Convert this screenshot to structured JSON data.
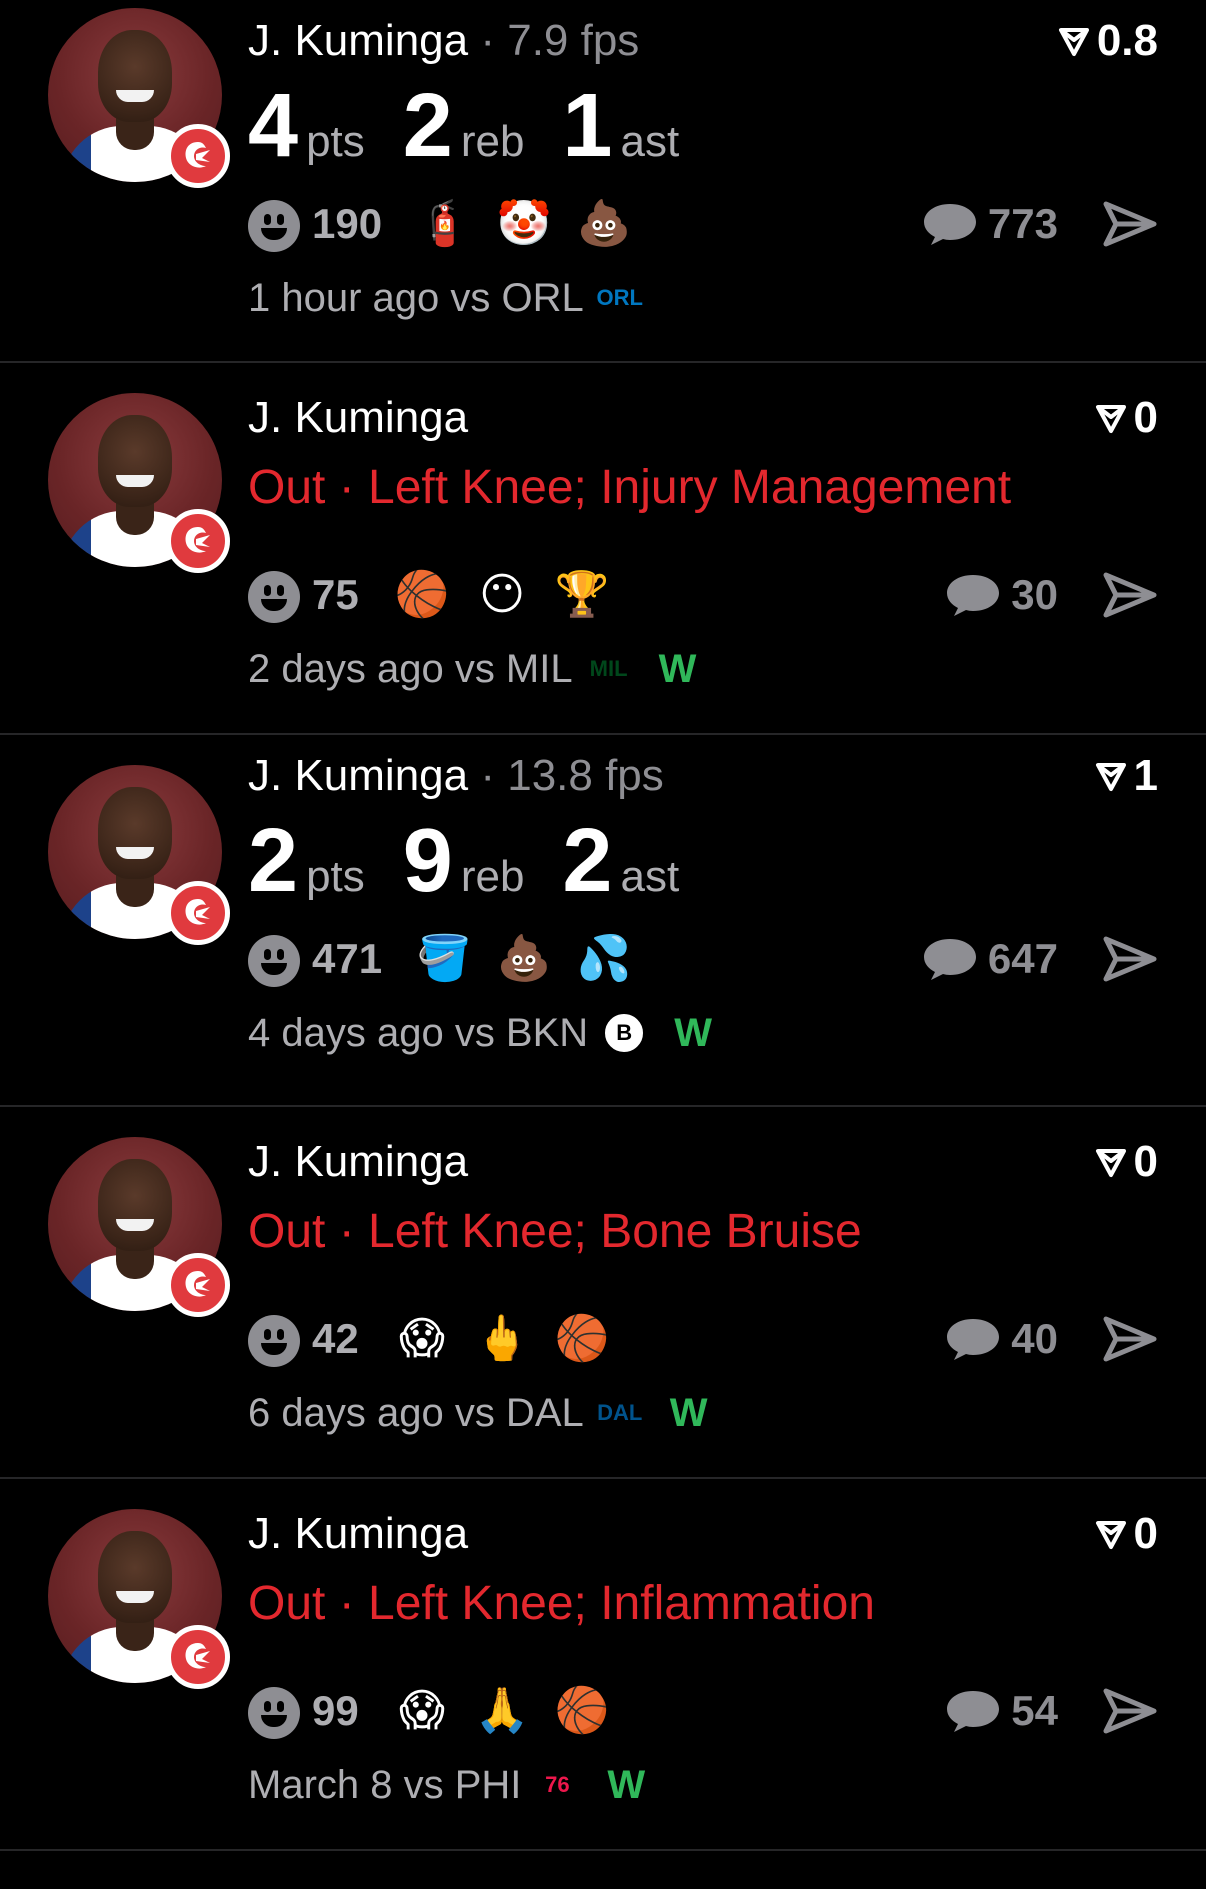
{
  "posts": [
    {
      "name": "J. Kuminga",
      "fps": "7.9 fps",
      "score": "0.8",
      "type": "stats",
      "stats": [
        {
          "num": "4",
          "unit": "pts"
        },
        {
          "num": "2",
          "unit": "reb"
        },
        {
          "num": "1",
          "unit": "ast"
        }
      ],
      "reaction_count": "190",
      "emojis": [
        "🧯",
        "🤡",
        "💩"
      ],
      "comment_count": "773",
      "meta": "1 hour ago vs ORL",
      "opponent_logo": "ORL",
      "opponent_color": "#0077c0",
      "result": ""
    },
    {
      "name": "J. Kuminga",
      "score": "0",
      "type": "injury",
      "injury": "Out · Left Knee; Injury Management",
      "reaction_count": "75",
      "emojis": [
        "🏀",
        "😶",
        "🏆"
      ],
      "comment_count": "30",
      "meta": "2 days ago vs MIL",
      "opponent_logo": "MIL",
      "opponent_color": "#00471b",
      "result": "W"
    },
    {
      "name": "J. Kuminga",
      "fps": "13.8 fps",
      "score": "1",
      "type": "stats",
      "stats": [
        {
          "num": "2",
          "unit": "pts"
        },
        {
          "num": "9",
          "unit": "reb"
        },
        {
          "num": "2",
          "unit": "ast"
        }
      ],
      "reaction_count": "471",
      "emojis": [
        "🪣",
        "💩",
        "💦"
      ],
      "comment_count": "647",
      "meta": "4 days ago vs BKN",
      "opponent_logo": "B",
      "opponent_color": "#ffffff",
      "result": "W"
    },
    {
      "name": "J. Kuminga",
      "score": "0",
      "type": "injury",
      "injury": "Out · Left Knee; Bone Bruise",
      "reaction_count": "42",
      "emojis": [
        "😱",
        "🖕",
        "🏀"
      ],
      "comment_count": "40",
      "meta": "6 days ago vs DAL",
      "opponent_logo": "DAL",
      "opponent_color": "#00538c",
      "result": "W"
    },
    {
      "name": "J. Kuminga",
      "score": "0",
      "type": "injury",
      "injury": "Out · Left Knee; Inflammation",
      "reaction_count": "99",
      "emojis": [
        "😱",
        "🙏",
        "🏀"
      ],
      "comment_count": "54",
      "meta": "March 8 vs PHI",
      "opponent_logo": "76",
      "opponent_color": "#ed174c",
      "result": "W"
    }
  ]
}
